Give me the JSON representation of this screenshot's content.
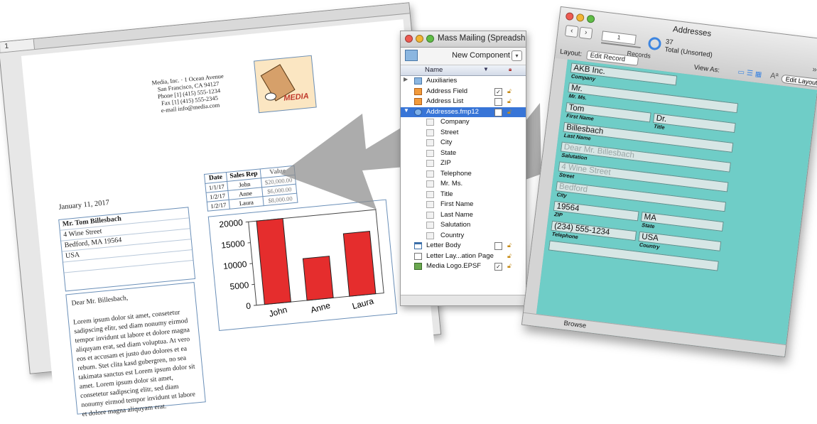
{
  "document": {
    "page_tab": "1",
    "return_address": [
      "Media, Inc. · 1 Ocean Avenue",
      "San Francisco, CA 94127",
      "Phone [1] (415) 555-1234",
      "Fax [1] (415) 555-2345",
      "e-mail info@media.com"
    ],
    "logo_text": "MEDIA",
    "date": "January 11, 2017",
    "recipient": [
      "Mr. Tom Billesbach",
      "4 Wine Street",
      "Bedford, MA 19564",
      "USA"
    ],
    "greeting": "Dear Mr. Billesbach,",
    "body_text": "Lorem ipsum dolor sit amet, consetetur sadipscing elitr, sed diam nonumy eirmod tempor invidunt ut labore et dolore magna aliquyam erat, sed diam voluptua. At vero eos et accusam et justo duo dolores et ea rebum. Stet clita kasd gubergren, no sea takimata sanctus est Lorem ipsum dolor sit amet. Lorem ipsum dolor sit amet, consetetur sadipscing elitr, sed diam nonumy eirmod tempor invidunt ut labore et dolore magna aliquyam erat.",
    "sales_table": {
      "headers": [
        "Date",
        "Sales Rep",
        "Value"
      ],
      "rows": [
        [
          "1/1/17",
          "John",
          "$20,000.00"
        ],
        [
          "1/2/17",
          "Anne",
          "$6,000.00"
        ],
        [
          "1/2/17",
          "Laura",
          "$8,000.00"
        ]
      ]
    }
  },
  "chart_data": {
    "type": "bar",
    "categories": [
      "John",
      "Anne",
      "Laura"
    ],
    "values": [
      20000,
      10000,
      15000
    ],
    "ylim": [
      0,
      20000
    ],
    "yticks": [
      "0",
      "5000",
      "10000",
      "15000",
      "20000"
    ],
    "bar_color": "#e52d2d"
  },
  "panel": {
    "title": "Mass Mailing (Spreadsh...",
    "new_component": "New Component",
    "column_header": "Name",
    "items": [
      {
        "label": "Auxiliaries",
        "icon": "folder-icon",
        "check": null
      },
      {
        "label": "Address Field",
        "icon": "table-icon",
        "check": "checked"
      },
      {
        "label": "Address List",
        "icon": "table-icon",
        "check": "unchecked"
      },
      {
        "label": "Addresses.fmp12",
        "icon": "database-icon",
        "check": "unchecked",
        "selected": true
      },
      {
        "label": "Company",
        "child": true
      },
      {
        "label": "Street",
        "child": true
      },
      {
        "label": "City",
        "child": true
      },
      {
        "label": "State",
        "child": true
      },
      {
        "label": "ZIP",
        "child": true
      },
      {
        "label": "Telephone",
        "child": true
      },
      {
        "label": "Mr. Ms.",
        "child": true
      },
      {
        "label": "Title",
        "child": true
      },
      {
        "label": "First Name",
        "child": true
      },
      {
        "label": "Last Name",
        "child": true
      },
      {
        "label": "Salutation",
        "child": true
      },
      {
        "label": "Country",
        "child": true
      },
      {
        "label": "Letter Body",
        "icon": "text-icon",
        "check": "unchecked"
      },
      {
        "label": "Letter Lay...ation Page",
        "icon": "page-icon",
        "check": null
      },
      {
        "label": "Media Logo.EPSF",
        "icon": "image-icon",
        "check": "checked"
      }
    ]
  },
  "addresses": {
    "title": "Addresses",
    "record_number": "1",
    "records_label": "Records",
    "total_count": "37",
    "total_label": "Total (Unsorted)",
    "layout_label": "Layout:",
    "layout_value": "Edit Record",
    "view_as": "View As:",
    "edit_layout": "Edit Layout",
    "mode": "Browse",
    "fields": [
      {
        "value": "AKB Inc.",
        "label": "Company"
      },
      {
        "value": "Mr.",
        "label": "Mr. Ms."
      },
      {
        "value": "Tom",
        "label": "First Name"
      },
      {
        "value": "Dr.",
        "label": "Title"
      },
      {
        "value": "Billesbach",
        "label": "Last Name"
      },
      {
        "value": "Dear Mr. Billesbach",
        "label": "Salutation"
      },
      {
        "value": "4 Wine Street",
        "label": "Street"
      },
      {
        "value": "Bedford",
        "label": "City"
      },
      {
        "value": "19564",
        "label": "ZIP"
      },
      {
        "value": "MA",
        "label": "State"
      },
      {
        "value": "(234) 555-1234",
        "label": "Telephone"
      },
      {
        "value": "USA",
        "label": "Country"
      }
    ]
  }
}
